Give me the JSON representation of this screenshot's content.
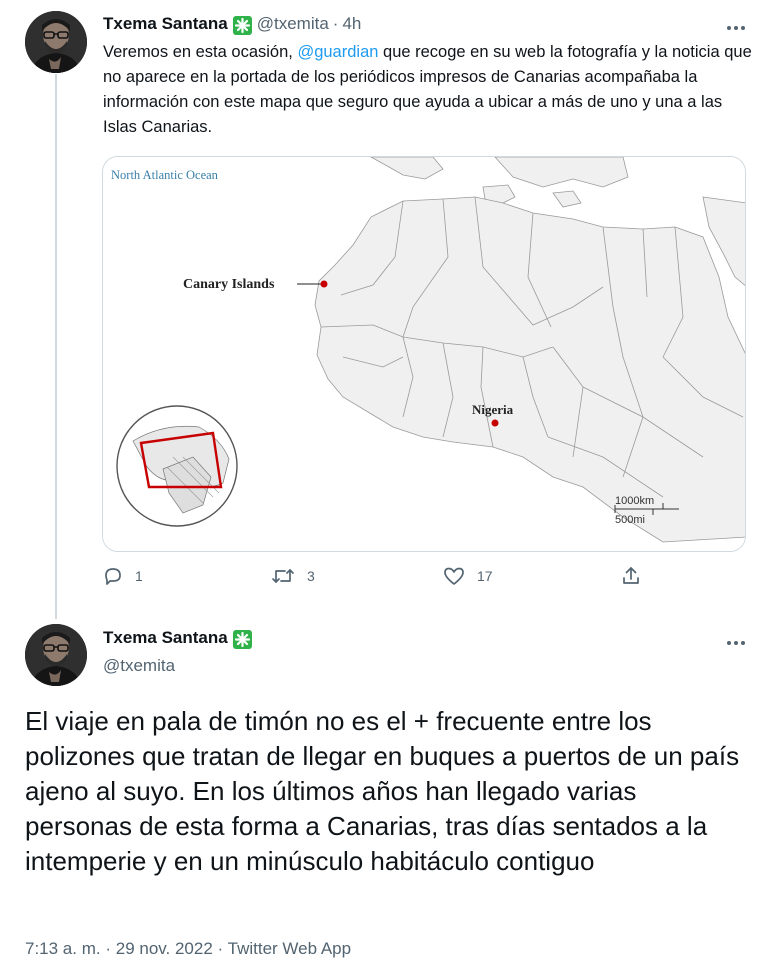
{
  "tweet1": {
    "author_name": "Txema Santana",
    "handle": "@txemita",
    "separator": "·",
    "time_ago": "4h",
    "text_before_mention": "Veremos en esta ocasión, ",
    "mention": "@guardian",
    "text_after_mention": " que recoge en su web la fotografía y la noticia que no aparece en la portada de los periódicos impresos de Canarias acompañaba la información con este mapa que seguro que ayuda a ubicar a más de uno y una a las Islas Canarias.",
    "more_icon": "more-horizontal-icon",
    "map": {
      "ocean_label": "North Atlantic Ocean",
      "canary_label": "Canary Islands",
      "nigeria_label": "Nigeria",
      "scale_km": "1000km",
      "scale_mi": "500mi",
      "marker_color": "#c70000",
      "inset_frame_color": "#c70000"
    },
    "actions": {
      "replies": "1",
      "retweets": "3",
      "likes": "17"
    }
  },
  "tweet2": {
    "author_name": "Txema Santana",
    "handle": "@txemita",
    "text": "El viaje en pala de timón no es el + frecuente entre los polizones que tratan de llegar en buques a puertos de un país ajeno al suyo. En los últimos años han llegado varias personas de esta forma a Canarias, tras días sentados a la intemperie y en un minúsculo habitáculo contiguo",
    "more_icon": "more-horizontal-icon",
    "time": "7:13 a. m.",
    "separator": "·",
    "date": "29 nov. 2022",
    "source": "Twitter Web App"
  },
  "colors": {
    "accent": "#1d9bf0",
    "verified_badge": "#2fb24a",
    "muted_text": "#536471"
  }
}
